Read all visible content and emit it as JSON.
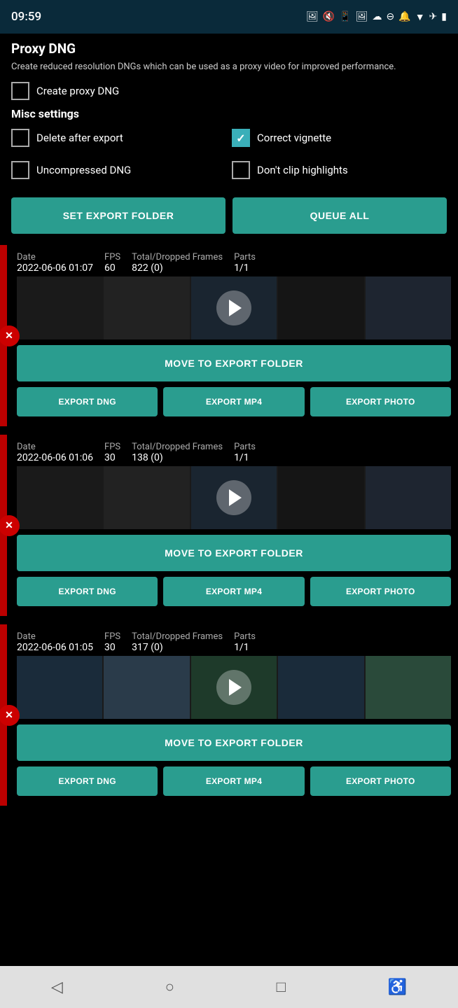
{
  "statusBar": {
    "time": "09:59",
    "icons": [
      "📷",
      "🔇",
      "📶",
      "✈",
      "🔋"
    ]
  },
  "header": {
    "title": "Proxy DNG",
    "description": "Create reduced resolution DNGs which can be used as a proxy video for improved performance."
  },
  "proxyDng": {
    "createProxy": {
      "label": "Create proxy DNG",
      "checked": false
    }
  },
  "miscSettings": {
    "title": "Misc settings",
    "options": [
      {
        "id": "delete-after-export",
        "label": "Delete after export",
        "checked": false
      },
      {
        "id": "correct-vignette",
        "label": "Correct vignette",
        "checked": true
      },
      {
        "id": "uncompressed-dng",
        "label": "Uncompressed DNG",
        "checked": false
      },
      {
        "id": "dont-clip-highlights",
        "label": "Don't clip highlights",
        "checked": false
      }
    ]
  },
  "buttons": {
    "setExportFolder": "SET EXPORT FOLDER",
    "queueAll": "QUEUE ALL"
  },
  "clips": [
    {
      "date_label": "Date",
      "date": "2022-06-06 01:07",
      "fps_label": "FPS",
      "fps": "60",
      "frames_label": "Total/Dropped Frames",
      "frames": "822 (0)",
      "parts_label": "Parts",
      "parts": "1/1",
      "moveToExportFolder": "MOVE TO EXPORT FOLDER",
      "exportDng": "EXPORT DNG",
      "exportMp4": "EXPORT MP4",
      "exportPhoto": "EXPORT PHOTO",
      "thumbStyle": "dark"
    },
    {
      "date_label": "Date",
      "date": "2022-06-06 01:06",
      "fps_label": "FPS",
      "fps": "30",
      "frames_label": "Total/Dropped Frames",
      "frames": "138 (0)",
      "parts_label": "Parts",
      "parts": "1/1",
      "moveToExportFolder": "MOVE TO EXPORT FOLDER",
      "exportDng": "EXPORT DNG",
      "exportMp4": "EXPORT MP4",
      "exportPhoto": "EXPORT PHOTO",
      "thumbStyle": "dark"
    },
    {
      "date_label": "Date",
      "date": "2022-06-06 01:05",
      "fps_label": "FPS",
      "fps": "30",
      "frames_label": "Total/Dropped Frames",
      "frames": "317 (0)",
      "parts_label": "Parts",
      "parts": "1/1",
      "moveToExportFolder": "MOVE TO EXPORT FOLDER",
      "exportDng": "EXPORT DNG",
      "exportMp4": "EXPORT MP4",
      "exportPhoto": "EXPORT PHOTO",
      "thumbStyle": "screen"
    }
  ],
  "bottomNav": {
    "back": "◁",
    "home": "○",
    "recent": "□",
    "accessibility": "♿"
  }
}
